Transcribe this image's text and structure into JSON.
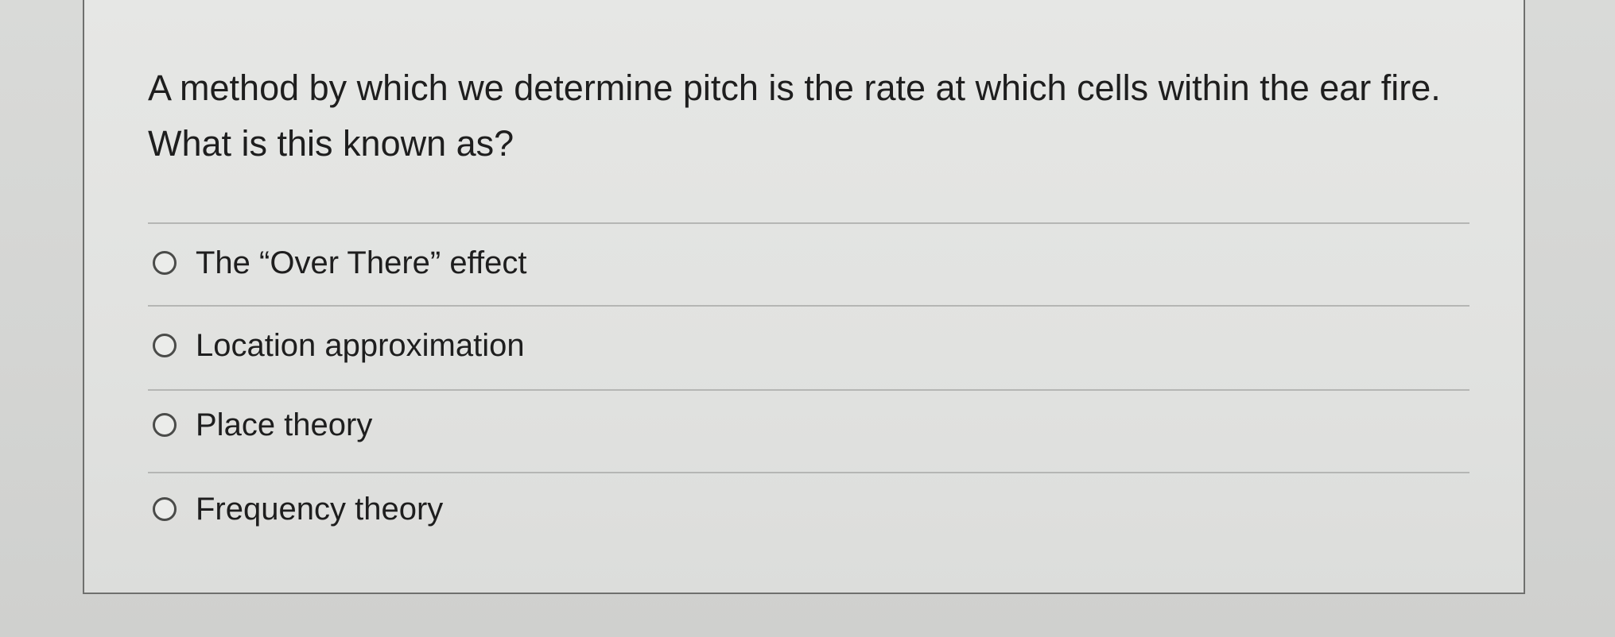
{
  "question": {
    "text": "A method by which we determine pitch is the rate at which cells within the ear fire.  What is this known as?"
  },
  "options": [
    {
      "label": "The “Over There” effect",
      "selected": false
    },
    {
      "label": "Location approximation",
      "selected": false
    },
    {
      "label": "Place theory",
      "selected": false
    },
    {
      "label": "Frequency theory",
      "selected": false
    }
  ]
}
